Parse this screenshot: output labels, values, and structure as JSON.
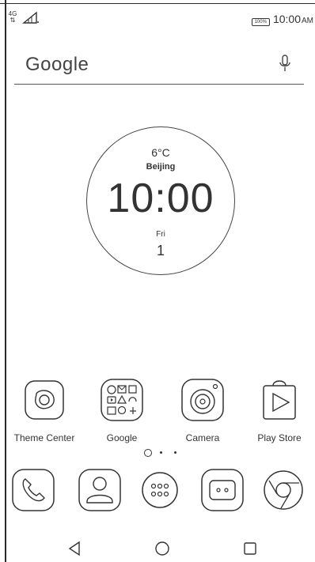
{
  "statusbar": {
    "network": "4G",
    "battery": "100%",
    "time": "10:00",
    "ampm": "AM"
  },
  "search": {
    "label": "Google"
  },
  "clock_widget": {
    "temperature": "6°C",
    "city": "Beijing",
    "time": "10:00",
    "day": "Fri",
    "date": "1"
  },
  "apps": [
    {
      "label": "Theme Center",
      "icon": "theme-center-icon"
    },
    {
      "label": "Google",
      "icon": "google-folder-icon"
    },
    {
      "label": "Camera",
      "icon": "camera-icon"
    },
    {
      "label": "Play Store",
      "icon": "play-store-icon"
    }
  ],
  "dock": [
    {
      "icon": "phone-icon"
    },
    {
      "icon": "contacts-icon"
    },
    {
      "icon": "app-drawer-icon"
    },
    {
      "icon": "messages-icon"
    },
    {
      "icon": "chrome-icon"
    }
  ],
  "nav": {
    "back": "back-icon",
    "home": "home-icon",
    "recents": "recents-icon"
  }
}
